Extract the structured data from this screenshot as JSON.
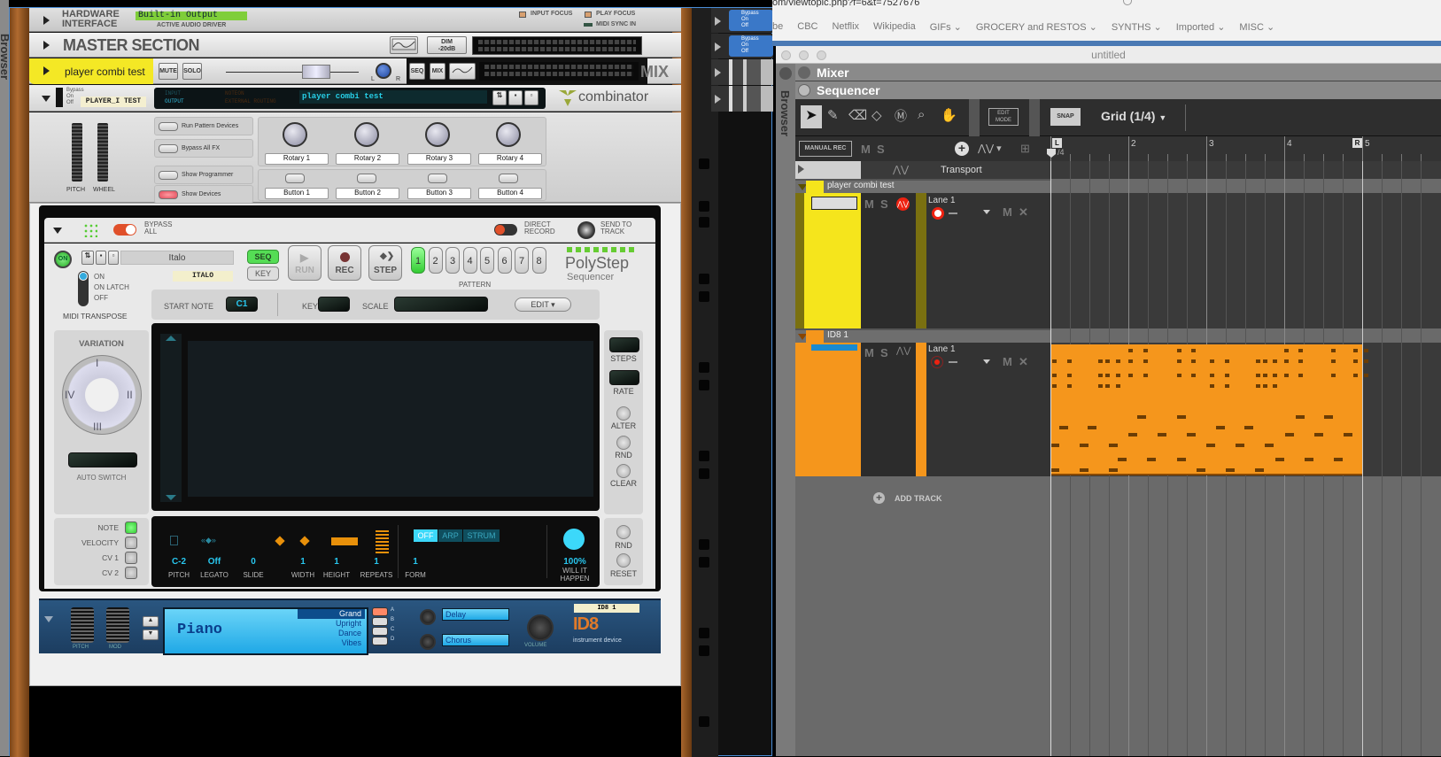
{
  "left_browser_label": "Browser",
  "rack": {
    "hardware_interface": {
      "title_line1": "HARDWARE",
      "title_line2": "INTERFACE",
      "driver": "Built-in Output",
      "driver_label": "ACTIVE AUDIO DRIVER",
      "input_focus": "INPUT FOCUS",
      "play_focus": "PLAY FOCUS",
      "midi_sync": "MIDI SYNC IN"
    },
    "master_section": {
      "title": "MASTER SECTION",
      "dim_label": "DIM\n-20dB"
    },
    "mix_channel": {
      "name": "player combi test",
      "mute": "MUTE",
      "solo": "SOLO",
      "seq": "SEQ",
      "mix": "MIX",
      "logo": "MIX",
      "pan_l": "L",
      "pan_r": "R"
    },
    "combinator": {
      "bypass": "Bypass",
      "on": "On",
      "off": "Off",
      "tape_label": "PLAYER_I TEST",
      "input": "INPUT",
      "output": "OUTPUT",
      "noteon": "NOTEON",
      "external_routing": "EXTERNAL ROUTING",
      "patch_name": "player combi test",
      "logo": "combinator",
      "pitch": "PITCH",
      "wheel": "WHEEL",
      "buttons_left": [
        "Run Pattern Devices",
        "Bypass All FX",
        "Show Programmer",
        "Show Devices"
      ],
      "rotaries": [
        "Rotary 1",
        "Rotary 2",
        "Rotary 3",
        "Rotary 4"
      ],
      "buttons": [
        "Button 1",
        "Button 2",
        "Button 3",
        "Button 4"
      ]
    },
    "polystep": {
      "bypass_all": "BYPASS\nALL",
      "direct_record": "DIRECT\nRECORD",
      "send_to_track": "SEND TO\nTRACK",
      "on": "ON",
      "patch": "Italo",
      "tape": "ITALO",
      "seq": "SEQ",
      "key": "KEY",
      "run": "RUN",
      "rec": "REC",
      "step": "STEP",
      "patterns": [
        "1",
        "2",
        "3",
        "4",
        "5",
        "6",
        "7",
        "8"
      ],
      "active_pattern": "1",
      "pattern_label": "PATTERN",
      "logo1": "PolyStep",
      "logo2": "Sequencer",
      "transpose_opts": [
        "ON",
        "ON LATCH",
        "OFF"
      ],
      "midi_transpose": "MIDI TRANSPOSE",
      "start_note_label": "START NOTE",
      "start_note": "C1",
      "key_label": "KEY",
      "scale_label": "SCALE",
      "edit": "EDIT ▾",
      "variation": "VARIATION",
      "var_i": "I",
      "var_ii": "II",
      "var_iii": "III",
      "var_iv": "IV",
      "auto_switch": "AUTO SWITCH",
      "steps": "STEPS",
      "rate": "RATE",
      "alter": "ALTER",
      "rnd": "RND",
      "clear": "CLEAR",
      "lanes": [
        "NOTE",
        "VELOCITY",
        "CV 1",
        "CV 2"
      ],
      "params": [
        {
          "value": "C-2",
          "label": "PITCH"
        },
        {
          "value": "Off",
          "label": "LEGATO"
        },
        {
          "value": "0",
          "label": "SLIDE"
        },
        {
          "value": "1",
          "label": "WIDTH"
        },
        {
          "value": "1",
          "label": "HEIGHT"
        },
        {
          "value": "1",
          "label": "REPEATS"
        },
        {
          "value": "1",
          "label": "FORM"
        }
      ],
      "modes": [
        "OFF",
        "ARP",
        "STRUM"
      ],
      "active_mode": "OFF",
      "probability": "100%",
      "probability_label": "WILL IT\nHAPPEN",
      "rnd2": "RND",
      "reset": "RESET"
    },
    "id8": {
      "pitch": "PITCH",
      "mod": "MOD",
      "category": "Piano",
      "variants": [
        "Grand",
        "Upright",
        "Dance",
        "Vibes"
      ],
      "selected_variant": "Grand",
      "slots": [
        "A",
        "B",
        "C",
        "D"
      ],
      "fx1": "Delay",
      "fx2": "Chorus",
      "volume": "VOLUME",
      "tape": "ID8 1",
      "logo": "ID8",
      "subtitle": "instrument device"
    },
    "side_devices": [
      {
        "bypass": "Bypass",
        "on": "On",
        "off": "Off"
      },
      {
        "bypass": "Bypass",
        "on": "On",
        "off": "Off"
      }
    ]
  },
  "browser": {
    "url": "om/viewtopic.php?f=6&t=7527676",
    "bookmarks": [
      "be",
      "CBC",
      "Netflix",
      "Wikipedia",
      "GIFs ⌄",
      "GROCERY and RESTOS ⌄",
      "SYNTHS ⌄",
      "Imported ⌄",
      "MISC ⌄"
    ]
  },
  "sequencer": {
    "window_title": "untitled",
    "mixer_label": "Mixer",
    "sequencer_label": "Sequencer",
    "browser_label": "Browser",
    "edit_mode": "EDIT\nMODE",
    "snap": "SNAP",
    "grid": "Grid (1/4)",
    "manual_rec": "MANUAL REC",
    "m": "M",
    "s": "S",
    "ruler": [
      "2",
      "3",
      "4",
      "5"
    ],
    "left_loc": "L",
    "right_loc": "R",
    "pos_sub": "/4",
    "transport": "Transport",
    "tracks": [
      {
        "name": "player combi test",
        "color": "#f5e51c",
        "lane": "Lane 1"
      },
      {
        "name": "ID8 1",
        "color": "#f5961c",
        "lane": "Lane 1"
      }
    ],
    "add_track": "ADD TRACK",
    "clip_color": "#f5961c"
  }
}
